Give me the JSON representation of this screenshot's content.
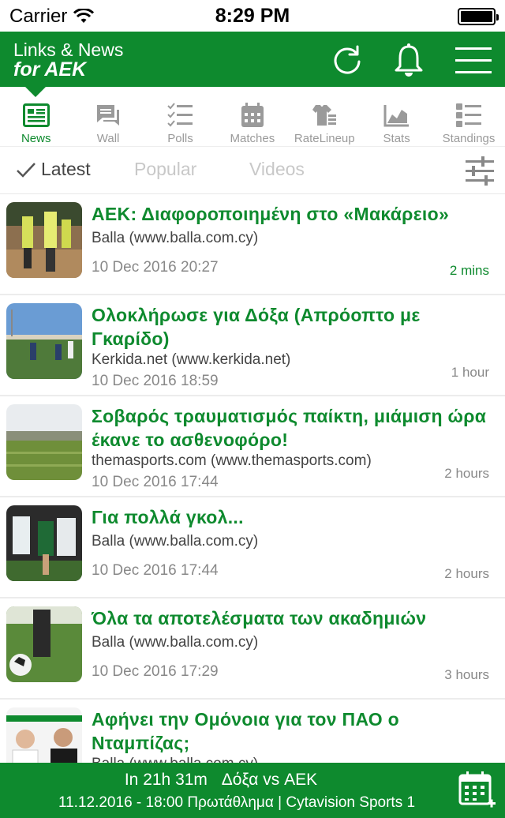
{
  "status_bar": {
    "carrier": "Carrier",
    "time": "8:29 PM"
  },
  "header": {
    "title_line1": "Links & News",
    "title_line2": "for AEK"
  },
  "tabs": [
    {
      "label": "News",
      "icon": "news-icon",
      "active": true
    },
    {
      "label": "Wall",
      "icon": "wall-icon"
    },
    {
      "label": "Polls",
      "icon": "polls-icon"
    },
    {
      "label": "Matches",
      "icon": "calendar-icon"
    },
    {
      "label": "RateLineup",
      "icon": "jersey-icon"
    },
    {
      "label": "Stats",
      "icon": "stats-chart-icon"
    },
    {
      "label": "Standings",
      "icon": "standings-icon"
    }
  ],
  "subtabs": {
    "latest": "Latest",
    "popular": "Popular",
    "videos": "Videos"
  },
  "news": [
    {
      "title": "ΑΕΚ: Διαφοροποιημένη στο «Μακάρειο»",
      "source": "Balla (www.balla.com.cy)",
      "date": "10 Dec 2016 20:27",
      "ago": "2 mins"
    },
    {
      "title": "Ολοκλήρωσε για Δόξα (Απρόοπτο με Γκαρίδο)",
      "source": "Kerkida.net (www.kerkida.net)",
      "date": "10 Dec 2016 18:59",
      "ago": "1 hour"
    },
    {
      "title": "Σοβαρός τραυματισμός παίκτη, μιάμιση ώρα έκανε το ασθενοφόρο!",
      "source": "themasports.com (www.themasports.com)",
      "date": "10 Dec 2016 17:44",
      "ago": "2 hours"
    },
    {
      "title": "Για πολλά γκολ...",
      "source": "Balla (www.balla.com.cy)",
      "date": "10 Dec 2016 17:44",
      "ago": "2 hours"
    },
    {
      "title": "Όλα τα αποτελέσματα των ακαδημιών",
      "source": "Balla (www.balla.com.cy)",
      "date": "10 Dec 2016 17:29",
      "ago": "3 hours"
    },
    {
      "title": "Αφήνει την Ομόνοια για τον ΠΑΟ ο Νταμπίζας;",
      "source": "Balla (www.balla.com.cy)",
      "date": "",
      "ago": ""
    }
  ],
  "next_match": {
    "countdown": "In 21h 31m",
    "teams": "Δόξα vs ΑΕΚ",
    "details": "11.12.2016 - 18:00  Πρωτάθλημα | Cytavision Sports 1"
  },
  "colors": {
    "brand": "#0e8a2e",
    "muted": "#9a9a9a"
  }
}
